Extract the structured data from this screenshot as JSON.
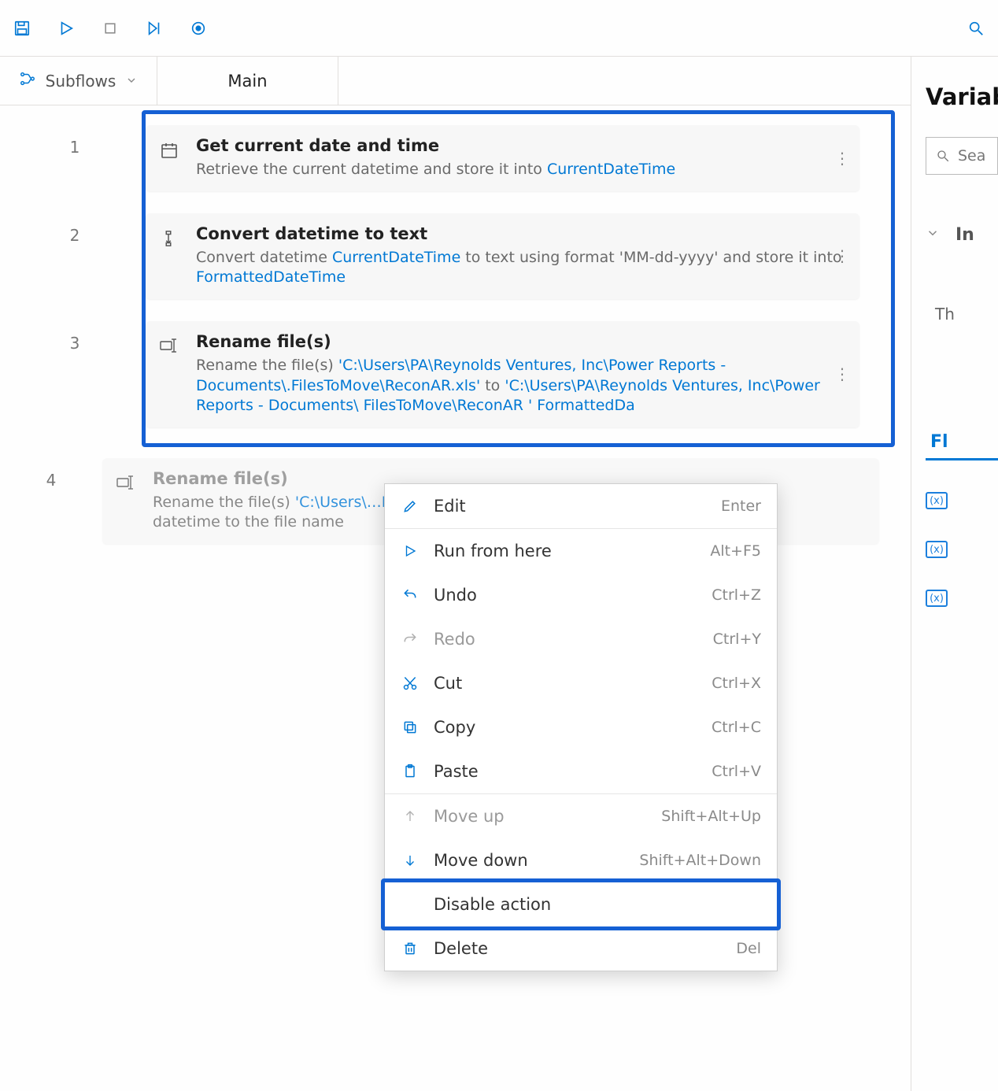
{
  "toolbar": {
    "save": "Save",
    "run": "Run",
    "stop": "Stop",
    "runNext": "Run next action",
    "recorder": "Recorder",
    "search": "Search"
  },
  "subflows": {
    "label": "Subflows"
  },
  "tabs": {
    "main": "Main"
  },
  "steps": [
    {
      "n": "1",
      "icon": "calendar-icon",
      "title": "Get current date and time",
      "desc_pre": "Retrieve the current datetime and store it into ",
      "var": "CurrentDateTime",
      "desc_post": ""
    },
    {
      "n": "2",
      "icon": "convert-icon",
      "title": "Convert datetime to text",
      "desc_pre": "Convert datetime ",
      "var": "CurrentDateTime",
      "desc_mid": " to text using format 'MM-dd-yyyy' and store it into ",
      "var2": "FormattedDateTime",
      "desc_post": ""
    },
    {
      "n": "3",
      "icon": "rename-icon",
      "title": "Rename file(s)",
      "desc_pre": "Rename the file(s) ",
      "path1": "'C:\\Users\\PA\\Reynolds Ventures, Inc\\Power Reports - Documents\\.FilesToMove\\ReconAR.xls'",
      "desc_mid": " to ",
      "path2": "'C:\\Users\\PA\\Reynolds Ventures, Inc\\Power Reports - Documents\\ FilesToMove\\ReconAR '",
      "var2": "FormattedDa",
      "desc_post": ""
    },
    {
      "n": "4",
      "icon": "rename-icon",
      "title": "Rename file(s)",
      "desc_pre": "Rename the file(s) ",
      "path1": "'C:\\Users\\…Reports - Documents\\.Fil…",
      "desc_post": " datetime to the file name"
    }
  ],
  "context": {
    "edit": {
      "label": "Edit",
      "sc": "Enter"
    },
    "runFrom": {
      "label": "Run from here",
      "sc": "Alt+F5"
    },
    "undo": {
      "label": "Undo",
      "sc": "Ctrl+Z"
    },
    "redo": {
      "label": "Redo",
      "sc": "Ctrl+Y"
    },
    "cut": {
      "label": "Cut",
      "sc": "Ctrl+X"
    },
    "copy": {
      "label": "Copy",
      "sc": "Ctrl+C"
    },
    "paste": {
      "label": "Paste",
      "sc": "Ctrl+V"
    },
    "moveUp": {
      "label": "Move up",
      "sc": "Shift+Alt+Up"
    },
    "moveDown": {
      "label": "Move down",
      "sc": "Shift+Alt+Down"
    },
    "disable": {
      "label": "Disable action",
      "sc": ""
    },
    "delete": {
      "label": "Delete",
      "sc": "Del"
    }
  },
  "vars": {
    "title": "Variabl",
    "searchPlaceholder": "Sea",
    "groupIn": "In",
    "msg": "Th",
    "tabFl": "Fl",
    "pill": "(x)"
  }
}
